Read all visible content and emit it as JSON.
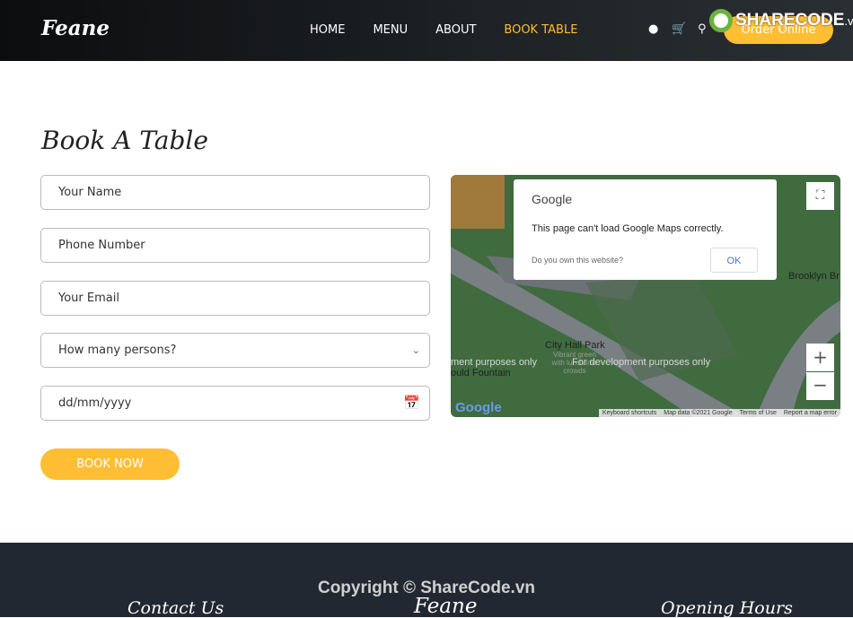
{
  "header": {
    "logo": "Feane",
    "nav": [
      {
        "label": "HOME",
        "active": false
      },
      {
        "label": "MENU",
        "active": false
      },
      {
        "label": "ABOUT",
        "active": false
      },
      {
        "label": "BOOK TABLE",
        "active": true
      }
    ],
    "icons": [
      "user-icon",
      "cart-icon",
      "search-icon"
    ],
    "order_button": "Order Online",
    "watermark": "SHARECODE",
    "watermark_suffix": ".vn"
  },
  "accent": "#ffbe33",
  "page_title": "Book A Table",
  "form": {
    "name_placeholder": "Your Name",
    "phone_placeholder": "Phone Number",
    "email_placeholder": "Your Email",
    "persons_select": "How many persons?",
    "date_placeholder": "dd/mm/yyyy",
    "submit": "BOOK NOW"
  },
  "map": {
    "dialog_brand": "Google",
    "dialog_message": "This page can't load Google Maps correctly.",
    "dialog_question": "Do you own this website?",
    "dialog_ok": "OK",
    "labels": [
      "City Hall Park",
      "For development purposes only",
      "ment purposes only",
      "Brooklyn Br",
      "ould Fountain",
      "Vibrant green with lunchtime crowds"
    ],
    "attribution": [
      "Keyboard shortcuts",
      "Map data ©2021 Google",
      "Terms of Use",
      "Report a map error"
    ],
    "google_logo": "Google",
    "watermark": "ShareCode.vn"
  },
  "footer": {
    "copyright": "Copyright © ShareCode.vn",
    "contact": "Contact Us",
    "logo": "Feane",
    "hours": "Opening Hours"
  }
}
